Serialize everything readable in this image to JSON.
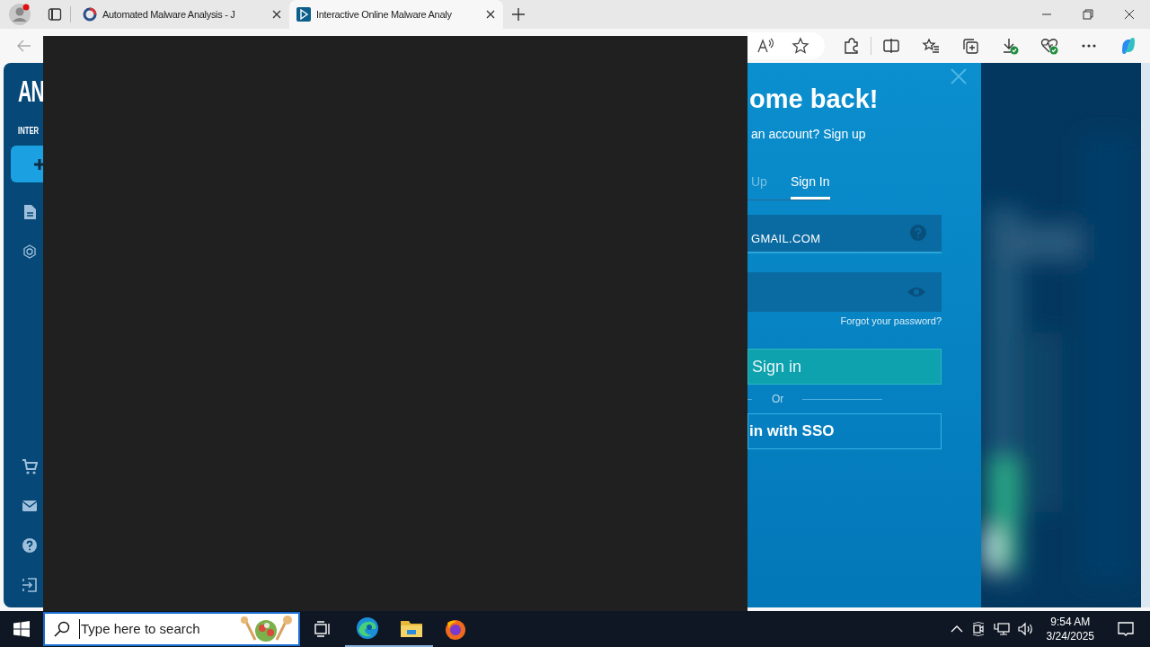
{
  "browser": {
    "tabs": [
      {
        "title": "Automated Malware Analysis - J",
        "selected": false
      },
      {
        "title": "Interactive Online Malware Analy",
        "selected": true
      }
    ]
  },
  "page": {
    "sidebar": {
      "logo": "AN",
      "subtitle": "INTER"
    },
    "login": {
      "title": "ome back!",
      "subtitle": "an account? Sign up",
      "tabs": [
        {
          "label": "Up",
          "selected": false
        },
        {
          "label": "Sign In",
          "selected": true
        }
      ],
      "email_value": "GMAIL.COM",
      "forgot_link": "Forgot your password?",
      "sign_in_button": "Sign in",
      "divider": "Or",
      "sso_button": "in with SSO"
    }
  },
  "taskbar": {
    "search_placeholder": "Type here to search",
    "time": "9:54 AM",
    "date": "3/24/2025"
  }
}
